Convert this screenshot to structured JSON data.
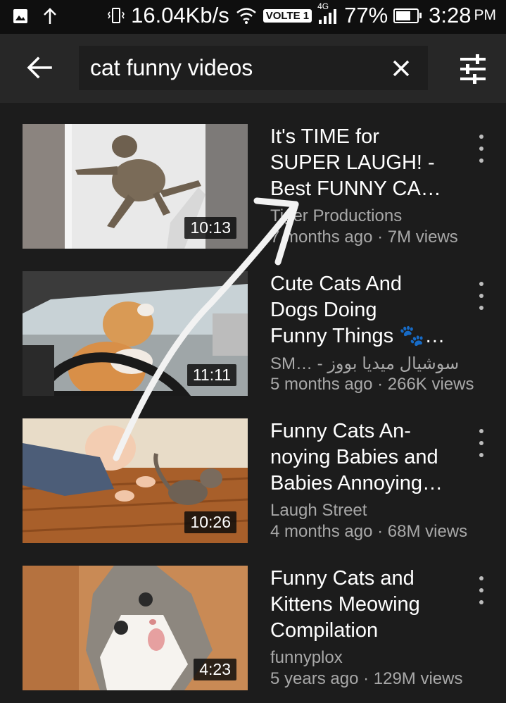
{
  "status_bar": {
    "speed": "16.04Kb/s",
    "network_badge": "VOLTE 1",
    "network_type": "4G",
    "battery_pct": "77%",
    "battery_level": 0.77,
    "time": "3:28",
    "ampm": "PM"
  },
  "search": {
    "query": "cat funny videos",
    "icons": {
      "back": "arrow-back-icon",
      "clear": "close-icon",
      "filter": "filter-sliders-icon"
    }
  },
  "results": [
    {
      "title": "It's TIME for\nSUPER LAUGH! -\nBest FUNNY CA…",
      "channel": "Tiger Productions",
      "meta": "7 months ago · 7M views",
      "duration": "10:13"
    },
    {
      "title": "Cute Cats And\nDogs Doing\nFunny Things 🐾…",
      "channel": "SM… - سوشيال ميديا بووز",
      "meta": "5 months ago · 266K views",
      "duration": "11:11"
    },
    {
      "title": "Funny Cats An-\nnoying Babies and\nBabies Annoying…",
      "channel": "Laugh Street",
      "meta": "4 months ago · 68M views",
      "duration": "10:26"
    },
    {
      "title": "Funny Cats and\nKittens Meowing\nCompilation",
      "channel": "funnyplox",
      "meta": "5 years ago · 129M views",
      "duration": "4:23"
    }
  ],
  "colors": {
    "background": "#1c1c1c",
    "header": "#272727",
    "search_field": "#1e1e1e",
    "secondary_text": "#a8a8a8"
  }
}
